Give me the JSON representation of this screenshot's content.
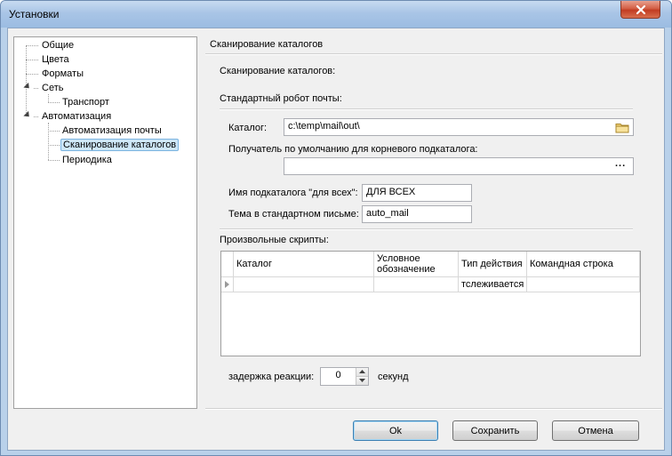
{
  "window": {
    "title": "Установки"
  },
  "tree": {
    "items": [
      {
        "label": "Общие"
      },
      {
        "label": "Цвета"
      },
      {
        "label": "Форматы"
      },
      {
        "label": "Сеть"
      },
      {
        "label": "Транспорт"
      },
      {
        "label": "Автоматизация"
      },
      {
        "label": "Автоматизация почты"
      },
      {
        "label": "Сканирование каталогов",
        "selected": true
      },
      {
        "label": "Периодика"
      }
    ]
  },
  "panel": {
    "title": "Сканирование каталогов",
    "section_heading": "Сканирование каталогов:",
    "robot_heading": "Стандартный робот почты:",
    "catalog_label": "Каталог:",
    "catalog_value": "c:\\temp\\mail\\out\\",
    "recipient_label": "Получатель по умолчанию для корневого подкаталога:",
    "recipient_value": "",
    "recipient_browse": "...",
    "subcatalog_label": "Имя подкаталога \"для всех\":",
    "subcatalog_value": "ДЛЯ ВСЕХ",
    "subject_label": "Тема в стандартном письме:",
    "subject_value": "auto_mail",
    "scripts_heading": "Произвольные скрипты:",
    "grid": {
      "columns": [
        "Каталог",
        "Условное обозначение",
        "Тип действия",
        "Командная строка"
      ],
      "rows": [
        {
          "catalog": "",
          "symbol": "",
          "action": "тслеживается",
          "command": ""
        }
      ]
    },
    "delay_label": "задержка реакции:",
    "delay_value": "0",
    "delay_unit": "секунд"
  },
  "buttons": {
    "ok": "Ok",
    "save": "Сохранить",
    "cancel": "Отмена"
  },
  "icons": {
    "close": "close-icon",
    "folder": "folder-icon",
    "row_pointer": "row-pointer-icon"
  }
}
